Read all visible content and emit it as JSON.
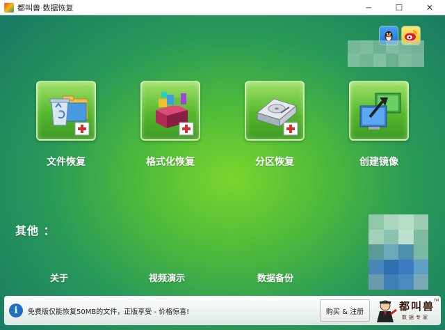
{
  "window": {
    "title": "都叫兽 数据恢复",
    "minimize_glyph": "─",
    "maximize_glyph": "☐",
    "close_glyph": "✕"
  },
  "social": {
    "qq_icon": "qq-penguin-icon",
    "weibo_icon": "weibo-icon"
  },
  "features": [
    {
      "label": "文件恢复",
      "icon": "recycle-bin-folder-icon"
    },
    {
      "label": "格式化恢复",
      "icon": "color-blocks-icon"
    },
    {
      "label": "分区恢复",
      "icon": "hard-drive-icon"
    },
    {
      "label": "创建镜像",
      "icon": "monitor-image-icon"
    }
  ],
  "others": {
    "title": "其他 ：",
    "links": [
      "关于",
      "视频演示",
      "数据备份"
    ]
  },
  "bottom": {
    "info_glyph": "i",
    "notice": "免费版仅能恢复50MB的文件，正版享受 - 价格惊喜!",
    "buy_button": "购买 & 注册",
    "brand_name": "都叫兽",
    "brand_sub": "数据专家",
    "brand_mark": "TM"
  },
  "colors": {
    "bg_center": "#7ad62d",
    "bg_edge": "#1a7d63",
    "tile": "#55b82c",
    "info_blue": "#1f6fc6"
  }
}
